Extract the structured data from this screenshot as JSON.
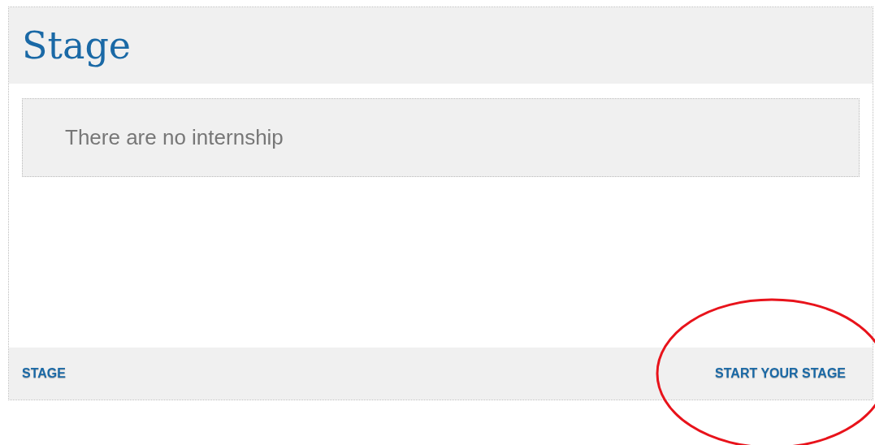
{
  "panel": {
    "title": "Stage",
    "message": "There are no internship",
    "footer_links": [
      "STAGE",
      "START YOUR STAGE"
    ]
  }
}
